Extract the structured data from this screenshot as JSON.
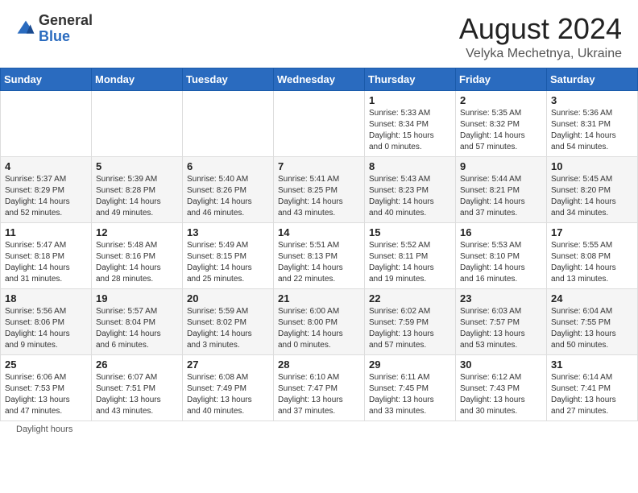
{
  "header": {
    "logo_general": "General",
    "logo_blue": "Blue",
    "month_year": "August 2024",
    "location": "Velyka Mechetnya, Ukraine"
  },
  "days_of_week": [
    "Sunday",
    "Monday",
    "Tuesday",
    "Wednesday",
    "Thursday",
    "Friday",
    "Saturday"
  ],
  "weeks": [
    [
      {
        "day": "",
        "info": ""
      },
      {
        "day": "",
        "info": ""
      },
      {
        "day": "",
        "info": ""
      },
      {
        "day": "",
        "info": ""
      },
      {
        "day": "1",
        "info": "Sunrise: 5:33 AM\nSunset: 8:34 PM\nDaylight: 15 hours\nand 0 minutes."
      },
      {
        "day": "2",
        "info": "Sunrise: 5:35 AM\nSunset: 8:32 PM\nDaylight: 14 hours\nand 57 minutes."
      },
      {
        "day": "3",
        "info": "Sunrise: 5:36 AM\nSunset: 8:31 PM\nDaylight: 14 hours\nand 54 minutes."
      }
    ],
    [
      {
        "day": "4",
        "info": "Sunrise: 5:37 AM\nSunset: 8:29 PM\nDaylight: 14 hours\nand 52 minutes."
      },
      {
        "day": "5",
        "info": "Sunrise: 5:39 AM\nSunset: 8:28 PM\nDaylight: 14 hours\nand 49 minutes."
      },
      {
        "day": "6",
        "info": "Sunrise: 5:40 AM\nSunset: 8:26 PM\nDaylight: 14 hours\nand 46 minutes."
      },
      {
        "day": "7",
        "info": "Sunrise: 5:41 AM\nSunset: 8:25 PM\nDaylight: 14 hours\nand 43 minutes."
      },
      {
        "day": "8",
        "info": "Sunrise: 5:43 AM\nSunset: 8:23 PM\nDaylight: 14 hours\nand 40 minutes."
      },
      {
        "day": "9",
        "info": "Sunrise: 5:44 AM\nSunset: 8:21 PM\nDaylight: 14 hours\nand 37 minutes."
      },
      {
        "day": "10",
        "info": "Sunrise: 5:45 AM\nSunset: 8:20 PM\nDaylight: 14 hours\nand 34 minutes."
      }
    ],
    [
      {
        "day": "11",
        "info": "Sunrise: 5:47 AM\nSunset: 8:18 PM\nDaylight: 14 hours\nand 31 minutes."
      },
      {
        "day": "12",
        "info": "Sunrise: 5:48 AM\nSunset: 8:16 PM\nDaylight: 14 hours\nand 28 minutes."
      },
      {
        "day": "13",
        "info": "Sunrise: 5:49 AM\nSunset: 8:15 PM\nDaylight: 14 hours\nand 25 minutes."
      },
      {
        "day": "14",
        "info": "Sunrise: 5:51 AM\nSunset: 8:13 PM\nDaylight: 14 hours\nand 22 minutes."
      },
      {
        "day": "15",
        "info": "Sunrise: 5:52 AM\nSunset: 8:11 PM\nDaylight: 14 hours\nand 19 minutes."
      },
      {
        "day": "16",
        "info": "Sunrise: 5:53 AM\nSunset: 8:10 PM\nDaylight: 14 hours\nand 16 minutes."
      },
      {
        "day": "17",
        "info": "Sunrise: 5:55 AM\nSunset: 8:08 PM\nDaylight: 14 hours\nand 13 minutes."
      }
    ],
    [
      {
        "day": "18",
        "info": "Sunrise: 5:56 AM\nSunset: 8:06 PM\nDaylight: 14 hours\nand 9 minutes."
      },
      {
        "day": "19",
        "info": "Sunrise: 5:57 AM\nSunset: 8:04 PM\nDaylight: 14 hours\nand 6 minutes."
      },
      {
        "day": "20",
        "info": "Sunrise: 5:59 AM\nSunset: 8:02 PM\nDaylight: 14 hours\nand 3 minutes."
      },
      {
        "day": "21",
        "info": "Sunrise: 6:00 AM\nSunset: 8:00 PM\nDaylight: 14 hours\nand 0 minutes."
      },
      {
        "day": "22",
        "info": "Sunrise: 6:02 AM\nSunset: 7:59 PM\nDaylight: 13 hours\nand 57 minutes."
      },
      {
        "day": "23",
        "info": "Sunrise: 6:03 AM\nSunset: 7:57 PM\nDaylight: 13 hours\nand 53 minutes."
      },
      {
        "day": "24",
        "info": "Sunrise: 6:04 AM\nSunset: 7:55 PM\nDaylight: 13 hours\nand 50 minutes."
      }
    ],
    [
      {
        "day": "25",
        "info": "Sunrise: 6:06 AM\nSunset: 7:53 PM\nDaylight: 13 hours\nand 47 minutes."
      },
      {
        "day": "26",
        "info": "Sunrise: 6:07 AM\nSunset: 7:51 PM\nDaylight: 13 hours\nand 43 minutes."
      },
      {
        "day": "27",
        "info": "Sunrise: 6:08 AM\nSunset: 7:49 PM\nDaylight: 13 hours\nand 40 minutes."
      },
      {
        "day": "28",
        "info": "Sunrise: 6:10 AM\nSunset: 7:47 PM\nDaylight: 13 hours\nand 37 minutes."
      },
      {
        "day": "29",
        "info": "Sunrise: 6:11 AM\nSunset: 7:45 PM\nDaylight: 13 hours\nand 33 minutes."
      },
      {
        "day": "30",
        "info": "Sunrise: 6:12 AM\nSunset: 7:43 PM\nDaylight: 13 hours\nand 30 minutes."
      },
      {
        "day": "31",
        "info": "Sunrise: 6:14 AM\nSunset: 7:41 PM\nDaylight: 13 hours\nand 27 minutes."
      }
    ]
  ],
  "footer": {
    "note": "Daylight hours"
  }
}
